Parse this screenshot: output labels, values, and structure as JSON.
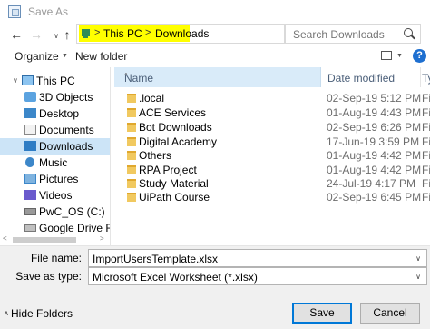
{
  "window": {
    "title": "Save As"
  },
  "navigation": {
    "back_glyph": "←",
    "forward_glyph": "→",
    "recent_glyph": "∨",
    "up_glyph": "↑",
    "breadcrumb": [
      "This PC",
      "Downloads"
    ],
    "separator": ">",
    "dropdown_glyph": "∨",
    "refresh_glyph": "↻",
    "search_placeholder": "Search Downloads"
  },
  "toolbar": {
    "organize_label": "Organize",
    "organize_arrow": "▼",
    "new_folder_label": "New folder",
    "view_arrow": "▼",
    "help_label": "?"
  },
  "sidebar": {
    "items": [
      {
        "label": "This PC",
        "icon": "computer-icon",
        "caret": "∨"
      },
      {
        "label": "3D Objects",
        "icon": "3d-objects-icon"
      },
      {
        "label": "Desktop",
        "icon": "desktop-icon"
      },
      {
        "label": "Documents",
        "icon": "documents-icon"
      },
      {
        "label": "Downloads",
        "icon": "downloads-icon",
        "selected": true
      },
      {
        "label": "Music",
        "icon": "music-icon"
      },
      {
        "label": "Pictures",
        "icon": "pictures-icon"
      },
      {
        "label": "Videos",
        "icon": "videos-icon"
      },
      {
        "label": "PwC_OS (C:)",
        "icon": "drive-icon"
      },
      {
        "label": "Google Drive File",
        "icon": "google-drive-icon"
      }
    ],
    "scroll_left": "<",
    "scroll_right": ">"
  },
  "file_list": {
    "columns": {
      "name": "Name",
      "date": "Date modified",
      "type": "Ty"
    },
    "sort_glyph": "^",
    "rows": [
      {
        "name": ".local",
        "date": "02-Sep-19 5:12 PM",
        "type": "Fi"
      },
      {
        "name": "ACE Services",
        "date": "01-Aug-19 4:43 PM",
        "type": "Fi"
      },
      {
        "name": "Bot Downloads",
        "date": "02-Sep-19 6:26 PM",
        "type": "Fi"
      },
      {
        "name": "Digital Academy",
        "date": "17-Jun-19 3:59 PM",
        "type": "Fi"
      },
      {
        "name": "Others",
        "date": "01-Aug-19 4:42 PM",
        "type": "Fi"
      },
      {
        "name": "RPA Project",
        "date": "01-Aug-19 4:42 PM",
        "type": "Fi"
      },
      {
        "name": "Study Material",
        "date": "24-Jul-19 4:17 PM",
        "type": "Fi"
      },
      {
        "name": "UiPath Course",
        "date": "02-Sep-19 6:45 PM",
        "type": "Fi"
      }
    ]
  },
  "form": {
    "file_name_label": "File name:",
    "file_name_value": "ImportUsersTemplate.xlsx",
    "save_as_type_label": "Save as type:",
    "save_as_type_value": "Microsoft Excel Worksheet (*.xlsx)",
    "dropdown_glyph": "∨"
  },
  "footer": {
    "hide_folders_label": "Hide Folders",
    "hide_caret": "∧",
    "save_label": "Save",
    "cancel_label": "Cancel"
  }
}
